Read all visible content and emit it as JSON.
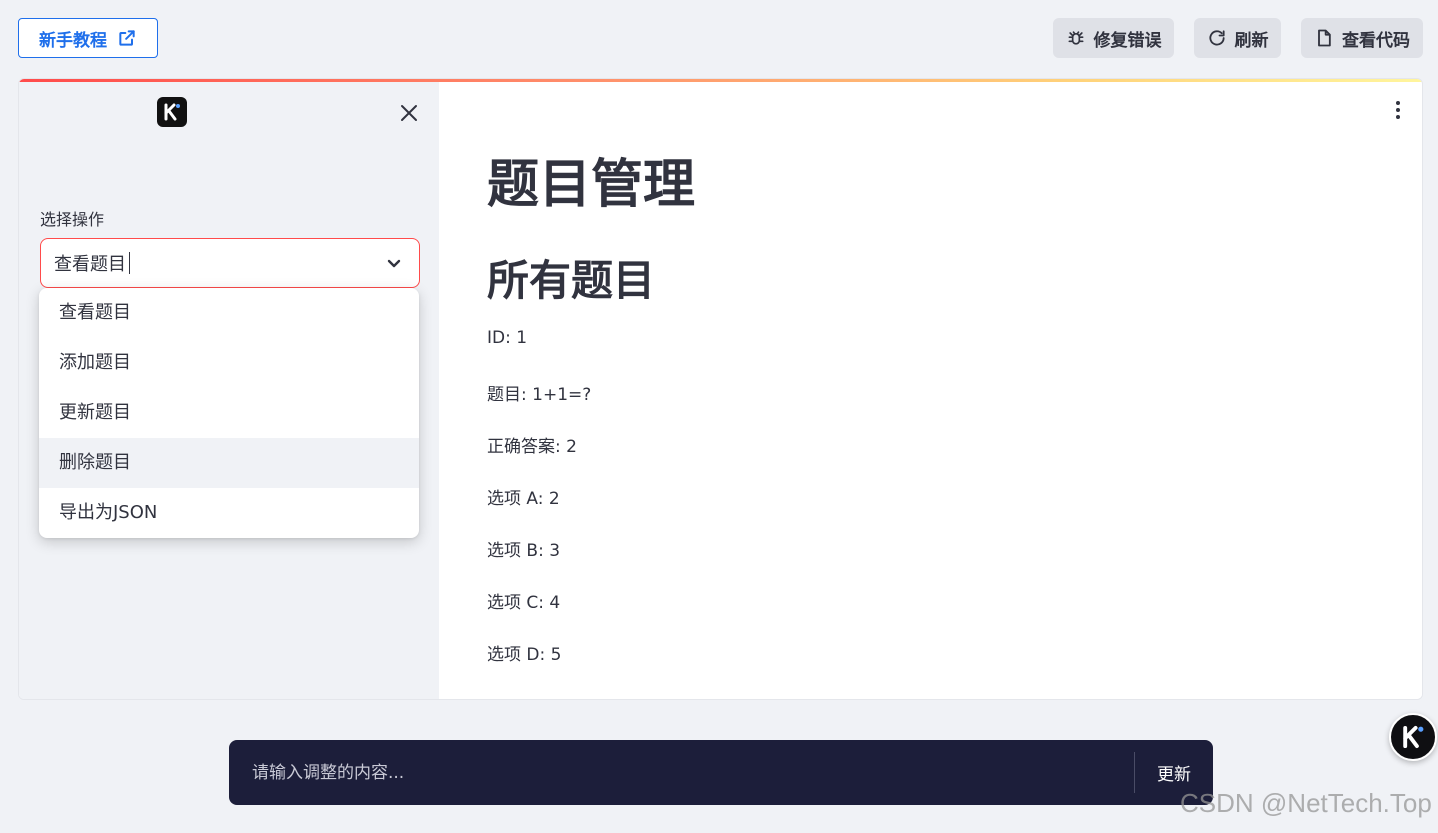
{
  "topbar": {
    "tutorial_label": "新手教程",
    "fix_label": "修复错误",
    "refresh_label": "刷新",
    "view_code_label": "查看代码"
  },
  "sidebar": {
    "select_label": "选择操作",
    "select_value": "查看题目",
    "options": [
      "查看题目",
      "添加题目",
      "更新题目",
      "删除题目",
      "导出为JSON"
    ],
    "hovered_option_index": 3
  },
  "main": {
    "title": "题目管理",
    "section_title": "所有题目",
    "fields": [
      "ID: 1",
      "题目: 1+1=?",
      "正确答案: 2",
      "选项 A: 2",
      "选项 B: 3",
      "选项 C: 4",
      "选项 D: 5"
    ]
  },
  "prompt": {
    "placeholder": "请输入调整的内容...",
    "submit_label": "更新"
  },
  "watermark": "CSDN @NetTech.Top",
  "colors": {
    "accent": "#1f6feb",
    "error_border": "#ff4b4b",
    "prompt_bg": "#1c1e3a",
    "sidebar_bg": "#f0f2f6"
  },
  "icons": {
    "tutorial": "external-link-icon",
    "fix": "bug-icon",
    "refresh": "refresh-icon",
    "view_code": "file-icon",
    "close": "close-icon",
    "chevron": "chevron-down-icon",
    "menu": "more-vertical-icon",
    "logo": "k-logo-icon"
  }
}
